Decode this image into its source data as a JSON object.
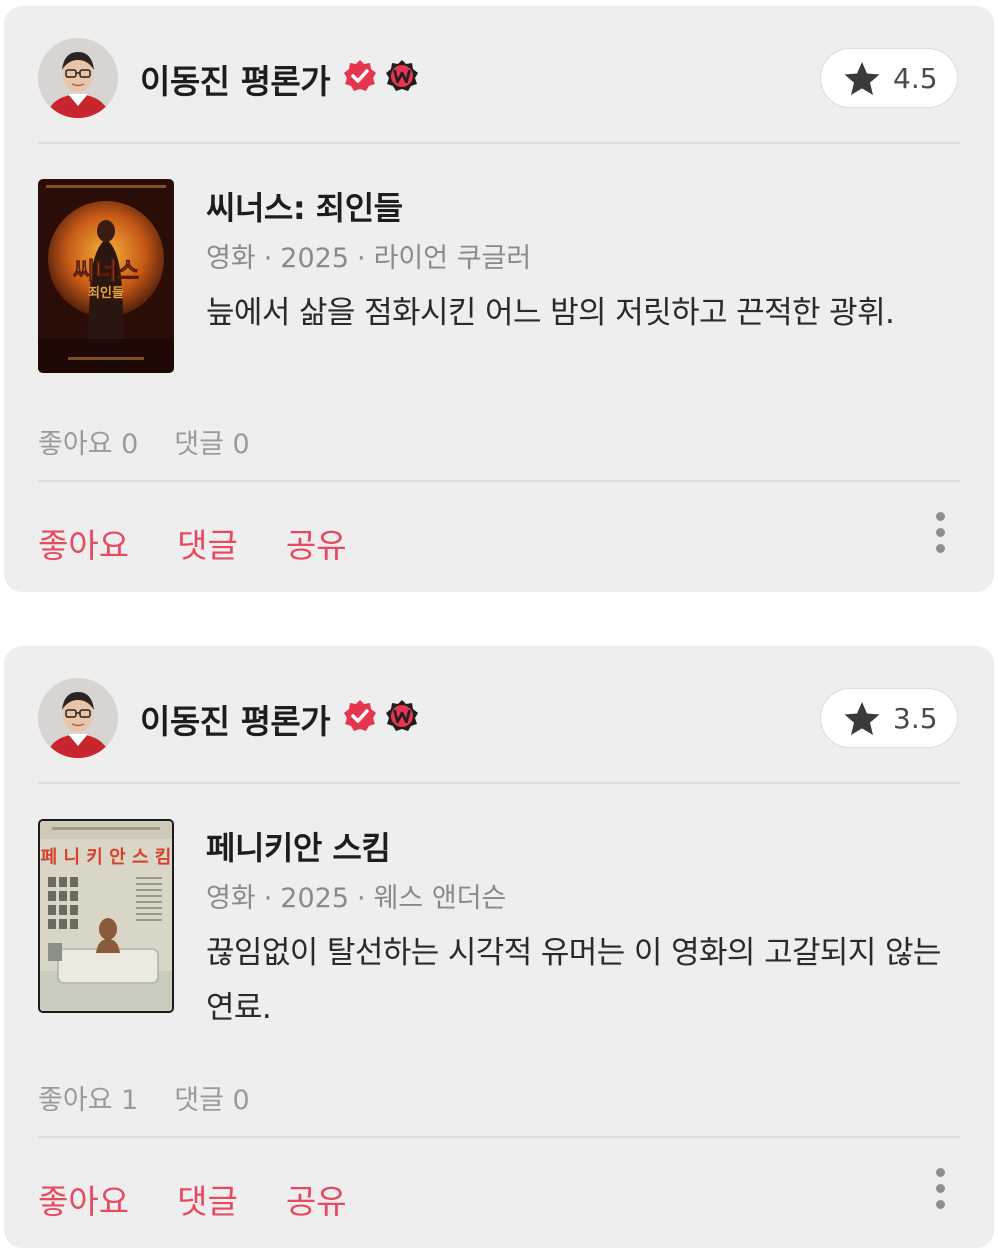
{
  "reviews": [
    {
      "author": "이동진 평론가",
      "rating": "4.5",
      "title": "씨너스: 죄인들",
      "media_type": "영화",
      "year": "2025",
      "director": "라이언 쿠글러",
      "text": "늪에서 삶을 점화시킨 어느 밤의 저릿하고 끈적한 광휘.",
      "likes_count": "좋아요 0",
      "comments_count": "댓글 0",
      "poster_title": "씨너스",
      "poster_subtitle": "죄인들",
      "actions": {
        "like": "좋아요",
        "comment": "댓글",
        "share": "공유"
      }
    },
    {
      "author": "이동진 평론가",
      "rating": "3.5",
      "title": "페니키안 스킴",
      "media_type": "영화",
      "year": "2025",
      "director": "웨스 앤더슨",
      "text": "끊임없이 탈선하는 시각적 유머는 이 영화의 고갈되지 않는 연료.",
      "likes_count": "좋아요 1",
      "comments_count": "댓글 0",
      "poster_title": "페 니 키 안  스 킴",
      "actions": {
        "like": "좋아요",
        "comment": "댓글",
        "share": "공유"
      }
    }
  ],
  "colors": {
    "accent": "#e64a5f",
    "card_bg": "#eeeeee",
    "verified_badge": "#e5354f",
    "w_badge": "#1f1f1f"
  },
  "icons": {
    "verified": "verified-check-icon",
    "watcha": "watcha-w-icon",
    "rating": "star-icon",
    "more": "more-vertical-icon"
  }
}
